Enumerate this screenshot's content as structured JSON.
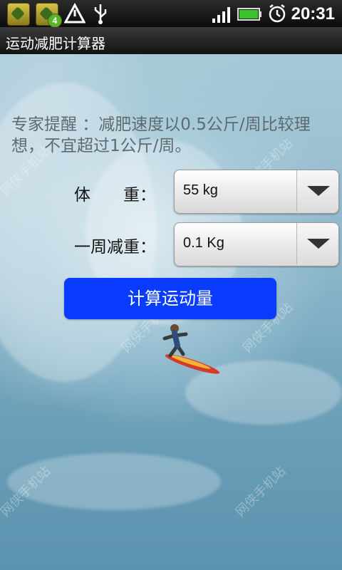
{
  "status_bar": {
    "time": "20:31",
    "notification_badge": "4",
    "icons": [
      "app-icon",
      "app-icon-with-badge",
      "warning-icon",
      "usb-icon",
      "signal-icon",
      "battery-icon",
      "alarm-icon"
    ]
  },
  "app": {
    "title": "运动减肥计算器"
  },
  "tip": {
    "text": "专家提醒 ：减肥速度以0.5公斤/周比较理想，不宜超过1公斤/周。"
  },
  "form": {
    "weight_label": "体　　重：",
    "weight_value": "55 kg",
    "weekly_loss_label": "一周减重：",
    "weekly_loss_value": "0.1 Kg"
  },
  "button": {
    "calculate_label": "计算运动量"
  },
  "watermark": {
    "text": "网侠手机站"
  },
  "colors": {
    "button_bg": "#0a3cff",
    "tip_text": "#5f6a70"
  }
}
